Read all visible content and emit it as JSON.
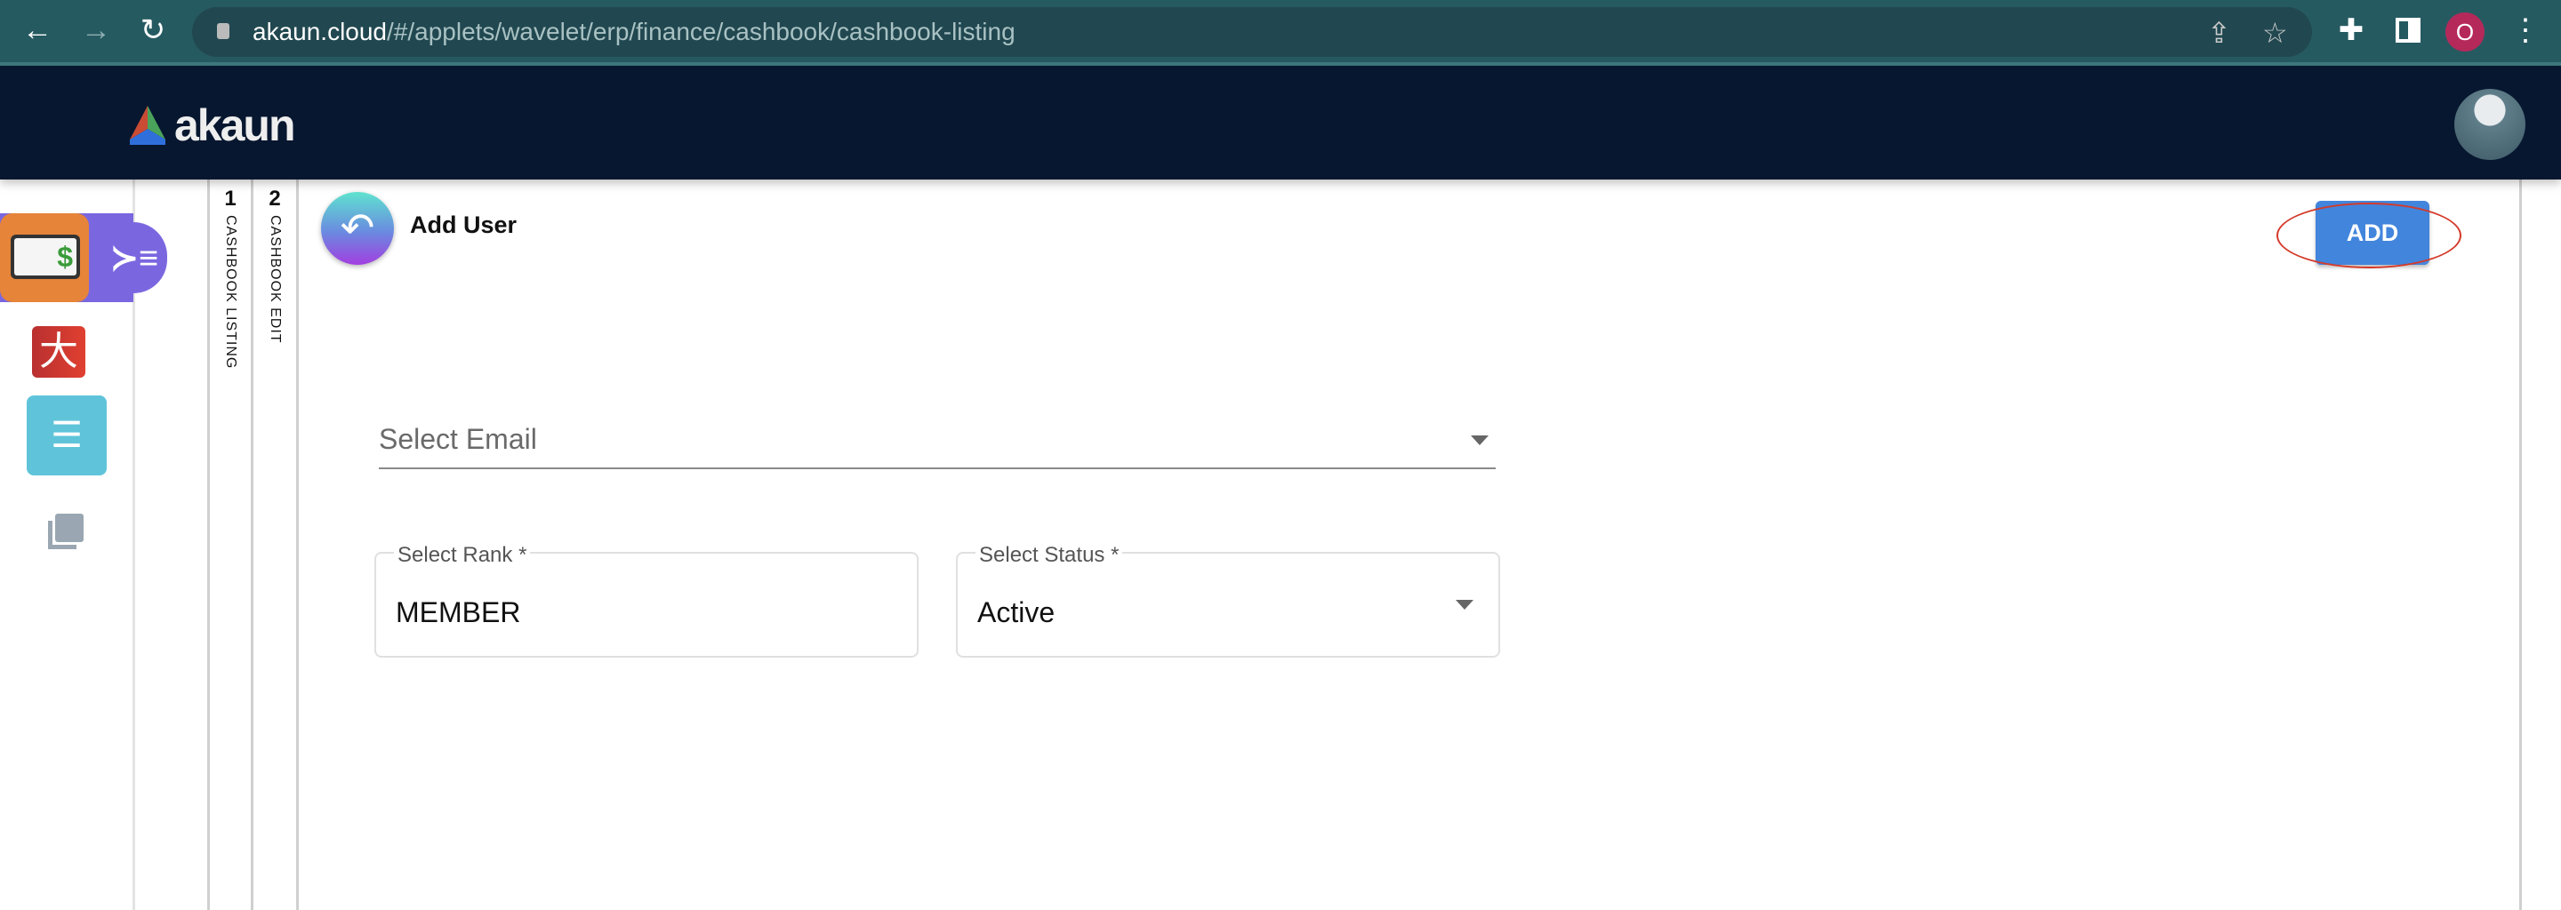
{
  "browser": {
    "url_host": "akaun.cloud",
    "url_path": "/#/applets/wavelet/erp/finance/cashbook/cashbook-listing",
    "profile_initial": "O"
  },
  "app": {
    "logo_text": "akaun"
  },
  "tabs": [
    {
      "number": "1",
      "label": "CASHBOOK LISTING"
    },
    {
      "number": "2",
      "label": "CASHBOOK EDIT"
    }
  ],
  "page": {
    "title": "Add User",
    "add_label": "ADD"
  },
  "form": {
    "email": {
      "placeholder": "Select Email"
    },
    "rank": {
      "label": "Select Rank *",
      "value": "MEMBER"
    },
    "status": {
      "label": "Select Status *",
      "value": "Active"
    }
  },
  "colors": {
    "accent": "#4285dc",
    "appbar": "#071730",
    "chrome": "#265a61",
    "highlight": "#d43a2a"
  }
}
